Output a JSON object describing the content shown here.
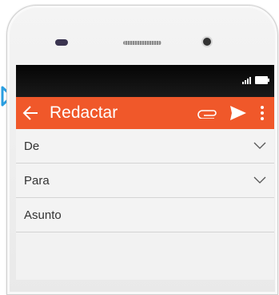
{
  "appbar": {
    "title": "Redactar",
    "color": "#f0582a"
  },
  "fields": {
    "from_label": "De",
    "to_label": "Para",
    "subject_label": "Asunto"
  },
  "icons": {
    "back": "arrow-left-icon",
    "attach": "paperclip-icon",
    "send": "send-icon",
    "more": "more-vert-icon",
    "signal": "signal-icon",
    "battery": "battery-icon",
    "marker": "play-outline-icon"
  }
}
